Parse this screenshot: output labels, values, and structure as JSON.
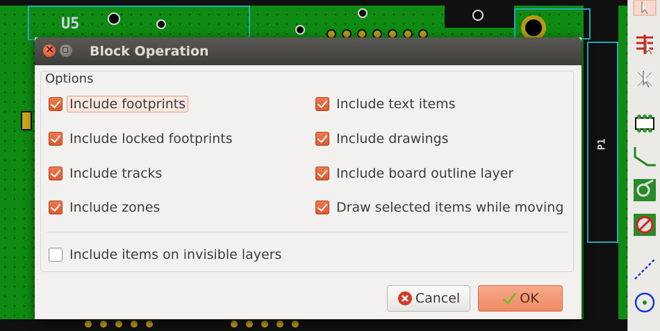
{
  "pcb": {
    "silkscreen_u5": "U5",
    "silkscreen_p1": "P1"
  },
  "dialog": {
    "title": "Block Operation",
    "options_heading": "Options",
    "options_left": [
      {
        "label": "Include footprints",
        "checked": true
      },
      {
        "label": "Include locked footprints",
        "checked": true
      },
      {
        "label": "Include tracks",
        "checked": true
      },
      {
        "label": "Include zones",
        "checked": true
      }
    ],
    "options_right": [
      {
        "label": "Include text items",
        "checked": true
      },
      {
        "label": "Include drawings",
        "checked": true
      },
      {
        "label": "Include board outline layer",
        "checked": true
      },
      {
        "label": "Draw selected items while moving",
        "checked": true
      }
    ],
    "option_invisible": {
      "label": "Include items on invisible layers",
      "checked": false
    },
    "cancel_label": "Cancel",
    "ok_label": "OK"
  },
  "colors": {
    "accent": "#e86a3e",
    "pcb_green": "#0f8a12",
    "titlebar": "#4a4945"
  },
  "toolbar_icons": [
    "select-arrow-icon",
    "net-highlight-icon",
    "local-ratsnest-icon",
    "add-footprint-icon",
    "route-track-icon",
    "add-via-icon",
    "keepout-zone-icon",
    "add-line-icon",
    "add-circle-icon"
  ]
}
